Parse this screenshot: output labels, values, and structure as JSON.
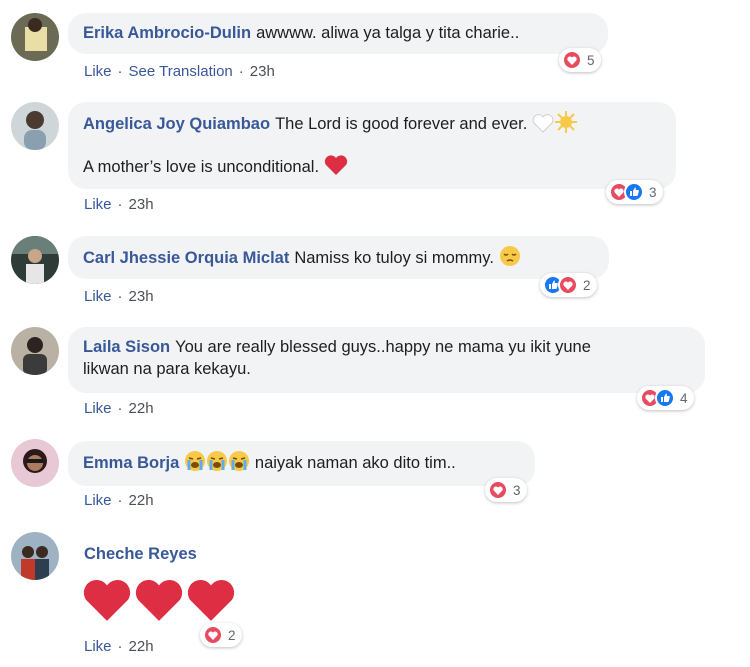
{
  "comments": [
    {
      "author": "Erika Ambrocio-Dulin",
      "text": "awwww. aliwa ya talga y tita charie..",
      "actions": {
        "like": "Like",
        "translate": "See Translation",
        "time": "23h"
      },
      "reactions": {
        "types": [
          "love"
        ],
        "count": "5"
      }
    },
    {
      "author": "Angelica Joy Quiambao",
      "text": "The Lord is good forever and ever.",
      "text2": "A mother’s love is unconditional.",
      "actions": {
        "like": "Like",
        "time": "23h"
      },
      "reactions": {
        "types": [
          "love",
          "like"
        ],
        "count": "3"
      }
    },
    {
      "author": "Carl Jhessie Orquia Miclat",
      "text": "Namiss ko tuloy si mommy.",
      "actions": {
        "like": "Like",
        "time": "23h"
      },
      "reactions": {
        "types": [
          "like",
          "love"
        ],
        "count": "2"
      }
    },
    {
      "author": "Laila Sison",
      "text": "You are really blessed guys..happy ne mama yu ikit yune",
      "text2": "likwan na para kekayu.",
      "actions": {
        "like": "Like",
        "time": "22h"
      },
      "reactions": {
        "types": [
          "love",
          "like"
        ],
        "count": "4"
      }
    },
    {
      "author": "Emma Borja",
      "text": "naiyak naman ako dito tim..",
      "actions": {
        "like": "Like",
        "time": "22h"
      },
      "reactions": {
        "types": [
          "love"
        ],
        "count": "3"
      }
    },
    {
      "author": "Cheche Reyes",
      "actions": {
        "like": "Like",
        "time": "22h"
      },
      "reactions": {
        "types": [
          "love"
        ],
        "count": "2"
      }
    }
  ],
  "separator": "·",
  "colors": {
    "author": "#385898",
    "bubble": "#f2f3f5",
    "love": "#e84a5f",
    "like": "#1877f2"
  }
}
